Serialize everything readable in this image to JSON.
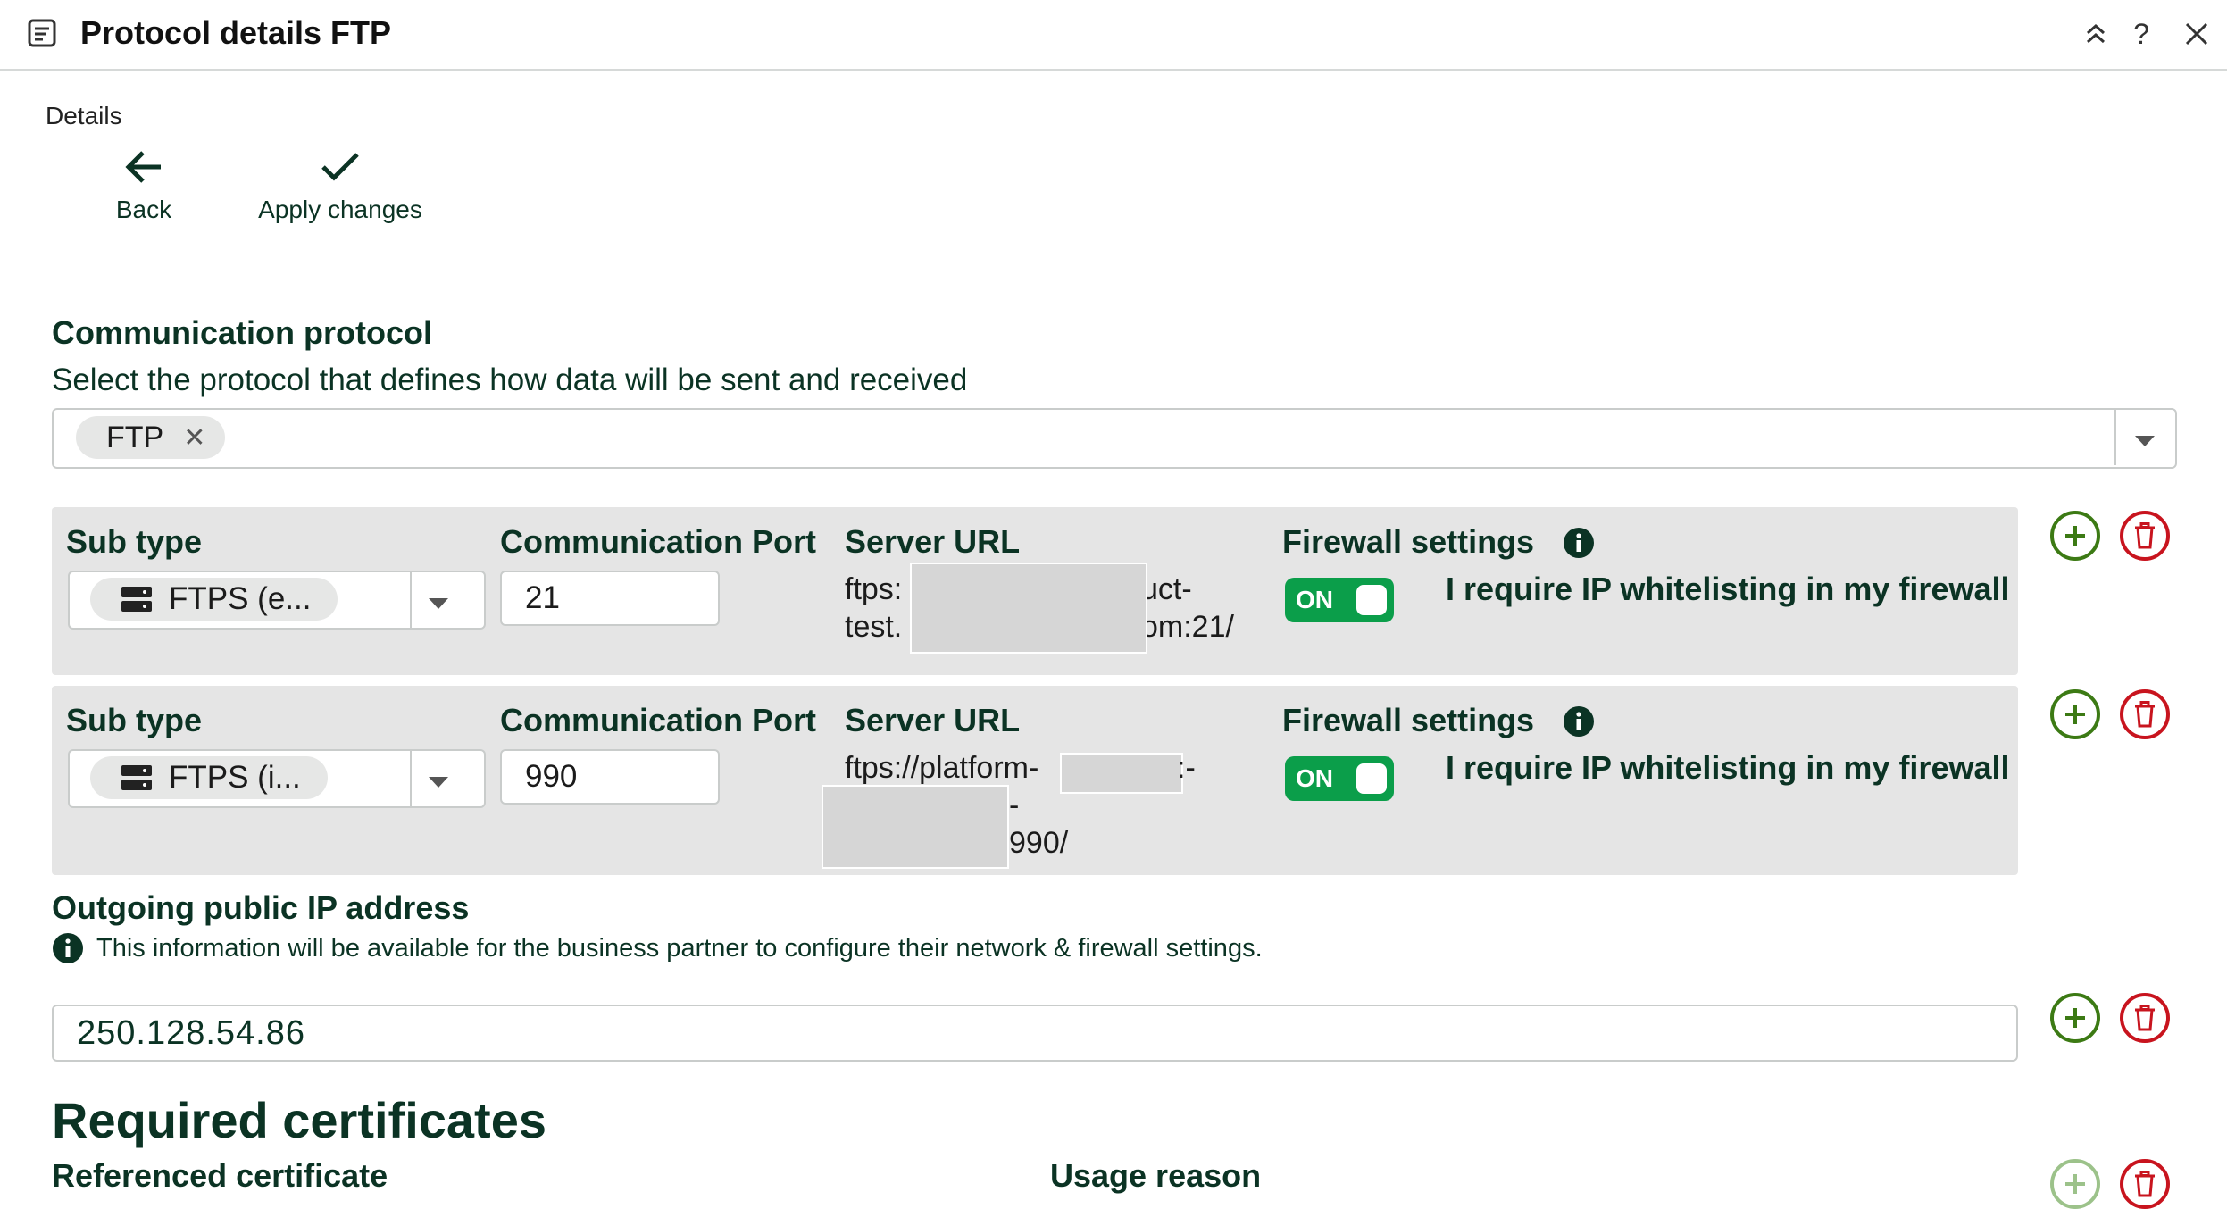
{
  "window": {
    "title": "Protocol details FTP",
    "icons": {
      "doc": "document-icon",
      "collapse": "collapse-up-icon",
      "help": "help-icon",
      "close": "close-icon"
    },
    "help_glyph": "?"
  },
  "toolbar": {
    "section_label": "Details",
    "back_label": "Back",
    "apply_label": "Apply changes"
  },
  "protocol": {
    "title": "Communication protocol",
    "description": "Select the protocol that defines how data will be sent and received",
    "selected": "FTP",
    "remove_glyph": "✕"
  },
  "labels": {
    "sub_type": "Sub type",
    "communication_port": "Communication Port",
    "server_url": "Server URL",
    "firewall_settings": "Firewall settings",
    "firewall_text": "I require IP whitelisting in my firewall",
    "toggle_on": "ON"
  },
  "rows": [
    {
      "sub_type": "FTPS (e...",
      "port": "21",
      "url_line1_prefix": "ftps:",
      "url_line1_suffix": "uct-",
      "url_line2_prefix": "test.",
      "url_line2_suffix": "om:21/",
      "firewall_on": true
    },
    {
      "sub_type": "FTPS (i...",
      "port": "990",
      "url_line1_prefix": "ftps://platform-",
      "url_line1_suffix": ":-",
      "url_line2_suffix": "-",
      "url_line3_suffix": "990/",
      "firewall_on": true
    }
  ],
  "outgoing_ip": {
    "title": "Outgoing public IP address",
    "info": "This information will be available for the business partner to configure their network & firewall settings.",
    "value": "250.128.54.86"
  },
  "certificates": {
    "title": "Required certificates",
    "col_referenced": "Referenced certificate",
    "col_usage": "Usage reason"
  },
  "colors": {
    "primary_text": "#0b3324",
    "toggle_on": "#0b9e4a",
    "add": "#3c7a14",
    "delete": "#c8141e",
    "row_bg": "#e5e5e5"
  }
}
